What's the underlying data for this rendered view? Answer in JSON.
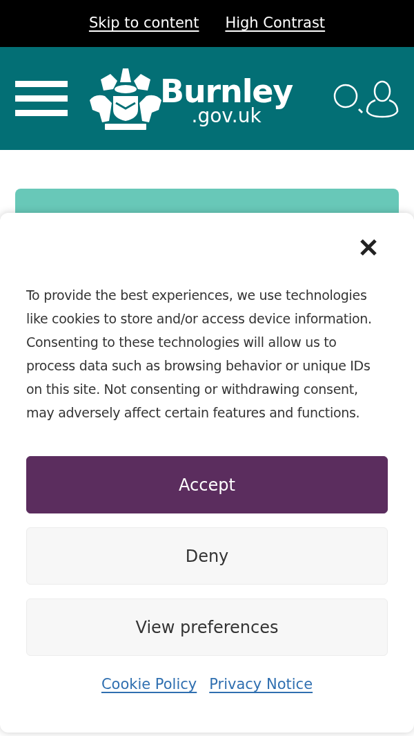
{
  "top_links": [
    "Skip to content",
    "High Contrast"
  ],
  "header": {
    "logo_name": "Burnley",
    "logo_suffix": ".gov.uk"
  },
  "cookie_banner": {
    "message": "To provide the best experiences, we use technologies like cookies to store and/or access device information. Consenting to these technologies will allow us to process data such as browsing behavior or unique IDs on this site. Not consenting or withdrawing consent, may adversely affect certain features and functions.",
    "buttons": [
      {
        "label": "Accept",
        "kind": "primary"
      },
      {
        "label": "Deny",
        "kind": "secondary"
      },
      {
        "label": "View preferences",
        "kind": "secondary"
      }
    ],
    "links": [
      "Cookie Policy",
      "Privacy Notice"
    ]
  }
}
